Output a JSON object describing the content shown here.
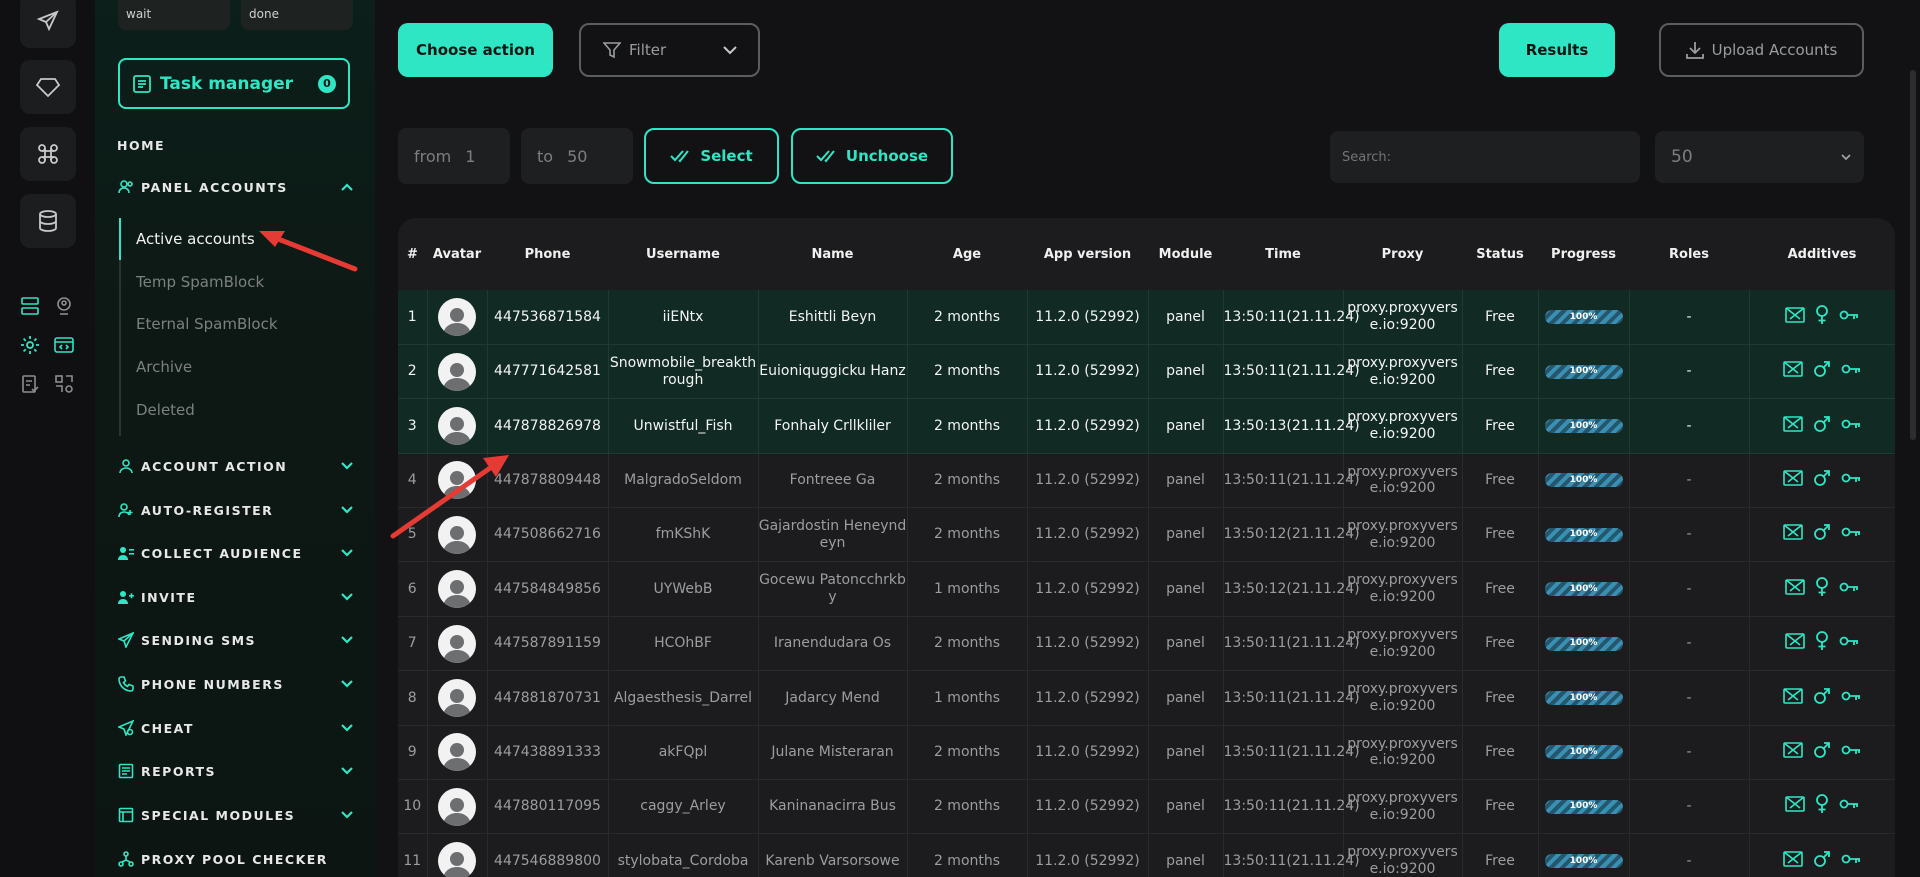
{
  "sidebar": {
    "status_boxes": [
      "wait",
      "done"
    ],
    "task_manager": {
      "label": "Task manager",
      "count": "0"
    },
    "home_label": "HOME",
    "panel_accounts": {
      "label": "PANEL ACCOUNTS",
      "items": [
        "Active accounts",
        "Temp SpamBlock",
        "Eternal SpamBlock",
        "Archive",
        "Deleted"
      ]
    },
    "sections": [
      "ACCOUNT ACTION",
      "AUTO-REGISTER",
      "COLLECT AUDIENCE",
      "INVITE",
      "SENDING SMS",
      "PHONE NUMBERS",
      "CHEAT",
      "REPORTS",
      "SPECIAL MODULES",
      "PROXY POOL CHECKER"
    ]
  },
  "toolbar": {
    "choose_action": "Choose action",
    "filter": "Filter",
    "results": "Results",
    "upload_accounts": "Upload Accounts",
    "from_label": "from",
    "from_value": "1",
    "to_label": "to",
    "to_value": "50",
    "select": "Select",
    "unchoose": "Unchoose",
    "search_placeholder": "Search:",
    "page_size": "50"
  },
  "table": {
    "columns": [
      "#",
      "Avatar",
      "Phone",
      "Username",
      "Name",
      "Age",
      "App version",
      "Module",
      "Time",
      "Proxy",
      "Status",
      "Progress",
      "Roles",
      "Additives"
    ],
    "rows": [
      {
        "n": "1",
        "phone": "447536871584",
        "username": "iiENtx",
        "name": "Eshittli Beyn",
        "age": "2 months",
        "app": "11.2.0 (52992)",
        "module": "panel",
        "time": "13:50:11(21.11.24)",
        "proxy": "proxy.proxyverse.io:9200",
        "status": "Free",
        "progress": "100%",
        "roles": "-",
        "gender": "female",
        "selected": true
      },
      {
        "n": "2",
        "phone": "447771642581",
        "username": "Snowmobile_breakthrough",
        "name": "Euioniquggicku Hanz",
        "age": "2 months",
        "app": "11.2.0 (52992)",
        "module": "panel",
        "time": "13:50:11(21.11.24)",
        "proxy": "proxy.proxyverse.io:9200",
        "status": "Free",
        "progress": "100%",
        "roles": "-",
        "gender": "male",
        "selected": true
      },
      {
        "n": "3",
        "phone": "447878826978",
        "username": "Unwistful_Fish",
        "name": "Fonhaly Crllkliler",
        "age": "2 months",
        "app": "11.2.0 (52992)",
        "module": "panel",
        "time": "13:50:13(21.11.24)",
        "proxy": "proxy.proxyverse.io:9200",
        "status": "Free",
        "progress": "100%",
        "roles": "-",
        "gender": "male",
        "selected": true
      },
      {
        "n": "4",
        "phone": "447878809448",
        "username": "MalgradoSeldom",
        "name": "Fontreee Ga",
        "age": "2 months",
        "app": "11.2.0 (52992)",
        "module": "panel",
        "time": "13:50:11(21.11.24)",
        "proxy": "proxy.proxyverse.io:9200",
        "status": "Free",
        "progress": "100%",
        "roles": "-",
        "gender": "male",
        "selected": false
      },
      {
        "n": "5",
        "phone": "447508662716",
        "username": "fmKShK",
        "name": "Gajardostin Heneyndeyn",
        "age": "2 months",
        "app": "11.2.0 (52992)",
        "module": "panel",
        "time": "13:50:12(21.11.24)",
        "proxy": "proxy.proxyverse.io:9200",
        "status": "Free",
        "progress": "100%",
        "roles": "-",
        "gender": "male",
        "selected": false
      },
      {
        "n": "6",
        "phone": "447584849856",
        "username": "UYWebB",
        "name": "Gocewu Patoncchrkby",
        "age": "1 months",
        "app": "11.2.0 (52992)",
        "module": "panel",
        "time": "13:50:12(21.11.24)",
        "proxy": "proxy.proxyverse.io:9200",
        "status": "Free",
        "progress": "100%",
        "roles": "-",
        "gender": "female",
        "selected": false
      },
      {
        "n": "7",
        "phone": "447587891159",
        "username": "HCOhBF",
        "name": "Iranendudara Os",
        "age": "2 months",
        "app": "11.2.0 (52992)",
        "module": "panel",
        "time": "13:50:11(21.11.24)",
        "proxy": "proxy.proxyverse.io:9200",
        "status": "Free",
        "progress": "100%",
        "roles": "-",
        "gender": "female",
        "selected": false
      },
      {
        "n": "8",
        "phone": "447881870731",
        "username": "Algaesthesis_Darrel",
        "name": "Jadarcy Mend",
        "age": "1 months",
        "app": "11.2.0 (52992)",
        "module": "panel",
        "time": "13:50:11(21.11.24)",
        "proxy": "proxy.proxyverse.io:9200",
        "status": "Free",
        "progress": "100%",
        "roles": "-",
        "gender": "male",
        "selected": false
      },
      {
        "n": "9",
        "phone": "447438891333",
        "username": "akFQpl",
        "name": "Julane Misteraran",
        "age": "2 months",
        "app": "11.2.0 (52992)",
        "module": "panel",
        "time": "13:50:11(21.11.24)",
        "proxy": "proxy.proxyverse.io:9200",
        "status": "Free",
        "progress": "100%",
        "roles": "-",
        "gender": "male",
        "selected": false
      },
      {
        "n": "10",
        "phone": "447880117095",
        "username": "caggy_Arley",
        "name": "Kaninanacirra Bus",
        "age": "2 months",
        "app": "11.2.0 (52992)",
        "module": "panel",
        "time": "13:50:11(21.11.24)",
        "proxy": "proxy.proxyverse.io:9200",
        "status": "Free",
        "progress": "100%",
        "roles": "-",
        "gender": "female",
        "selected": false
      },
      {
        "n": "11",
        "phone": "447546889800",
        "username": "stylobata_Cordoba",
        "name": "Karenb Varsorsowe",
        "age": "2 months",
        "app": "11.2.0 (52992)",
        "module": "panel",
        "time": "13:50:11(21.11.24)",
        "proxy": "proxy.proxyverse.io:9200",
        "status": "Free",
        "progress": "100%",
        "roles": "-",
        "gender": "male",
        "selected": false
      }
    ]
  },
  "colors": {
    "accent": "#2ee6c4",
    "selected_row": "#112a23",
    "background": "#121214"
  }
}
